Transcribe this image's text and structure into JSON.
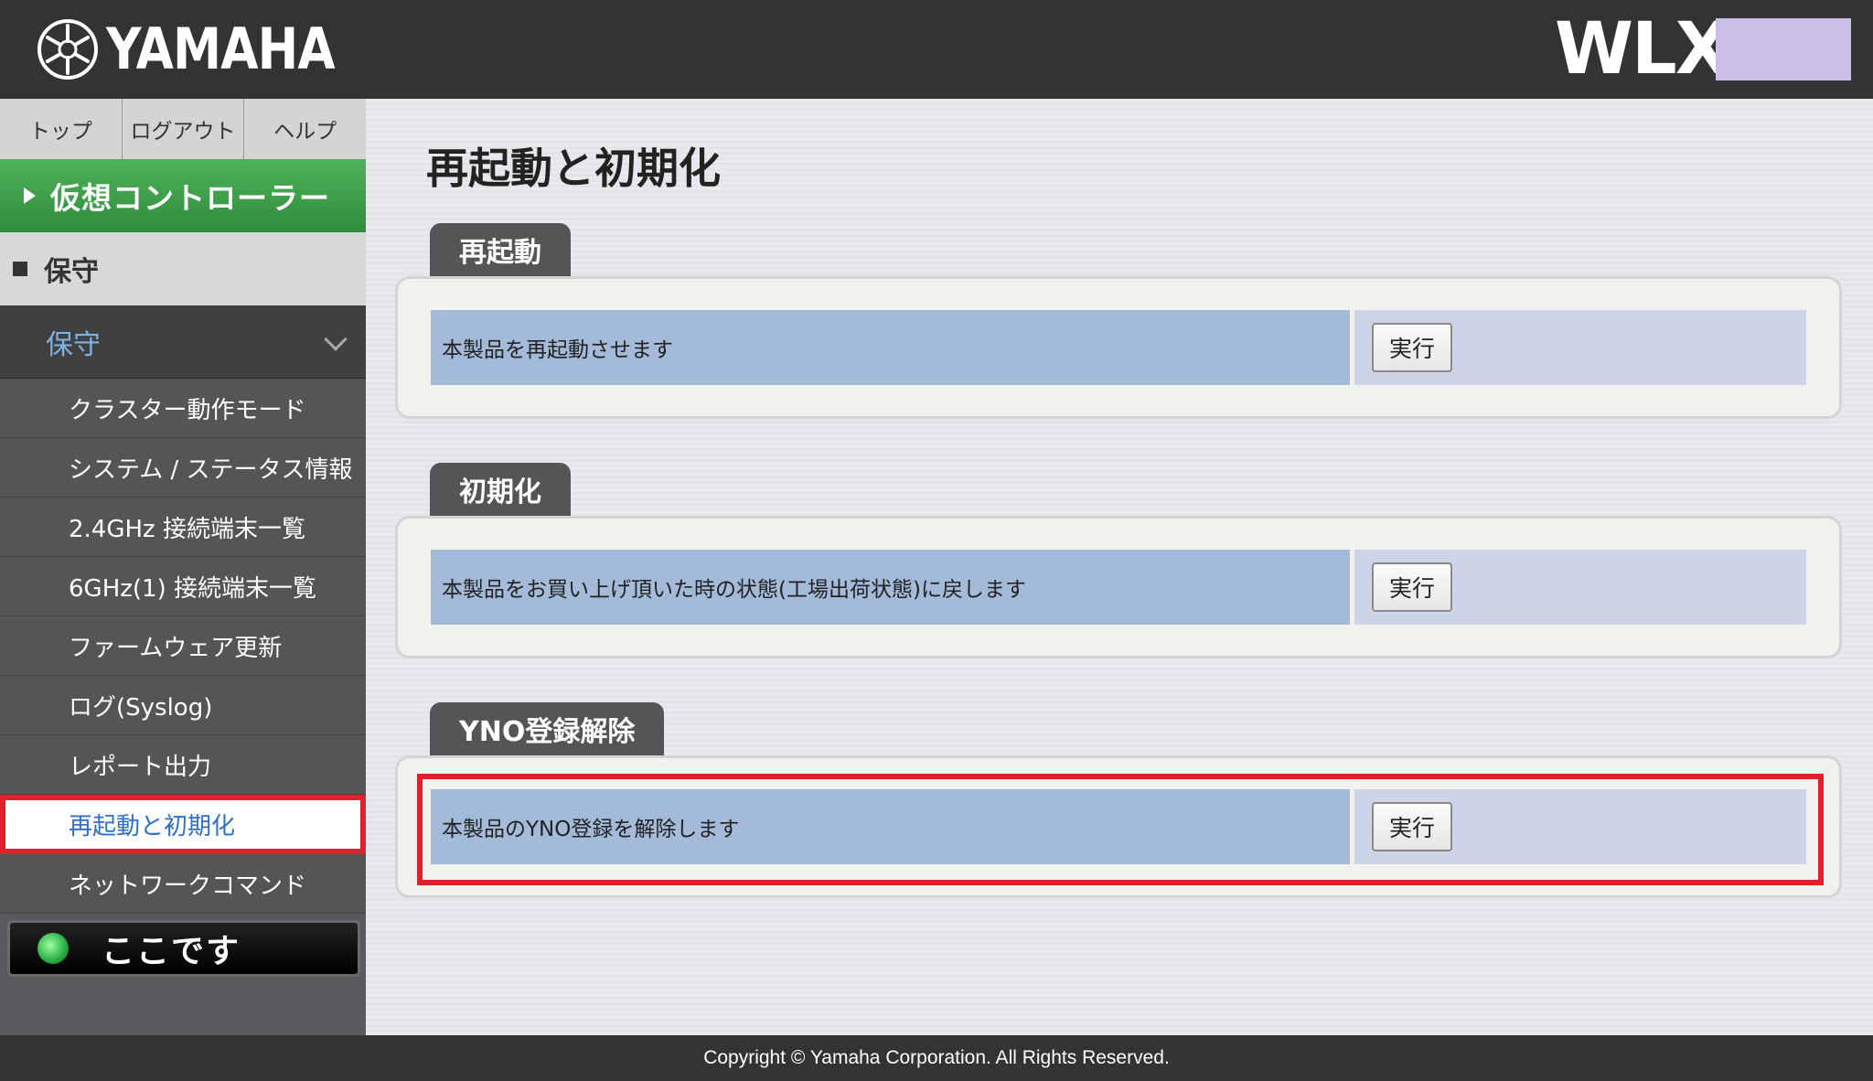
{
  "header": {
    "brand": "YAMAHA",
    "model": "WLX"
  },
  "sidebar": {
    "topnav": [
      {
        "label": "トップ"
      },
      {
        "label": "ログアウト"
      },
      {
        "label": "ヘルプ"
      }
    ],
    "virtual_controller": "仮想コントローラー",
    "section": "保守",
    "subsection": "保守",
    "menu": [
      {
        "label": "クラスター動作モード"
      },
      {
        "label": "システム / ステータス情報"
      },
      {
        "label": "2.4GHz 接続端末一覧"
      },
      {
        "label": "6GHz(1) 接続端末一覧"
      },
      {
        "label": "ファームウェア更新"
      },
      {
        "label": "ログ(Syslog)"
      },
      {
        "label": "レポート出力"
      },
      {
        "label": "再起動と初期化"
      },
      {
        "label": "ネットワークコマンド"
      }
    ],
    "here_label": "ここです"
  },
  "main": {
    "title": "再起動と初期化",
    "sections": [
      {
        "tab": "再起動",
        "description": "本製品を再起動させます",
        "button": "実行"
      },
      {
        "tab": "初期化",
        "description": "本製品をお買い上げ頂いた時の状態(工場出荷状態)に戻します",
        "button": "実行"
      },
      {
        "tab": "YNO登録解除",
        "description": "本製品のYNO登録を解除します",
        "button": "実行"
      }
    ]
  },
  "footer": {
    "copyright": "Copyright © Yamaha Corporation. All Rights Reserved."
  },
  "colors": {
    "header_bg": "#333333",
    "accent_green": "#3fa34d",
    "highlight_red": "#e0202c",
    "active_text_blue": "#2f6fc7"
  }
}
